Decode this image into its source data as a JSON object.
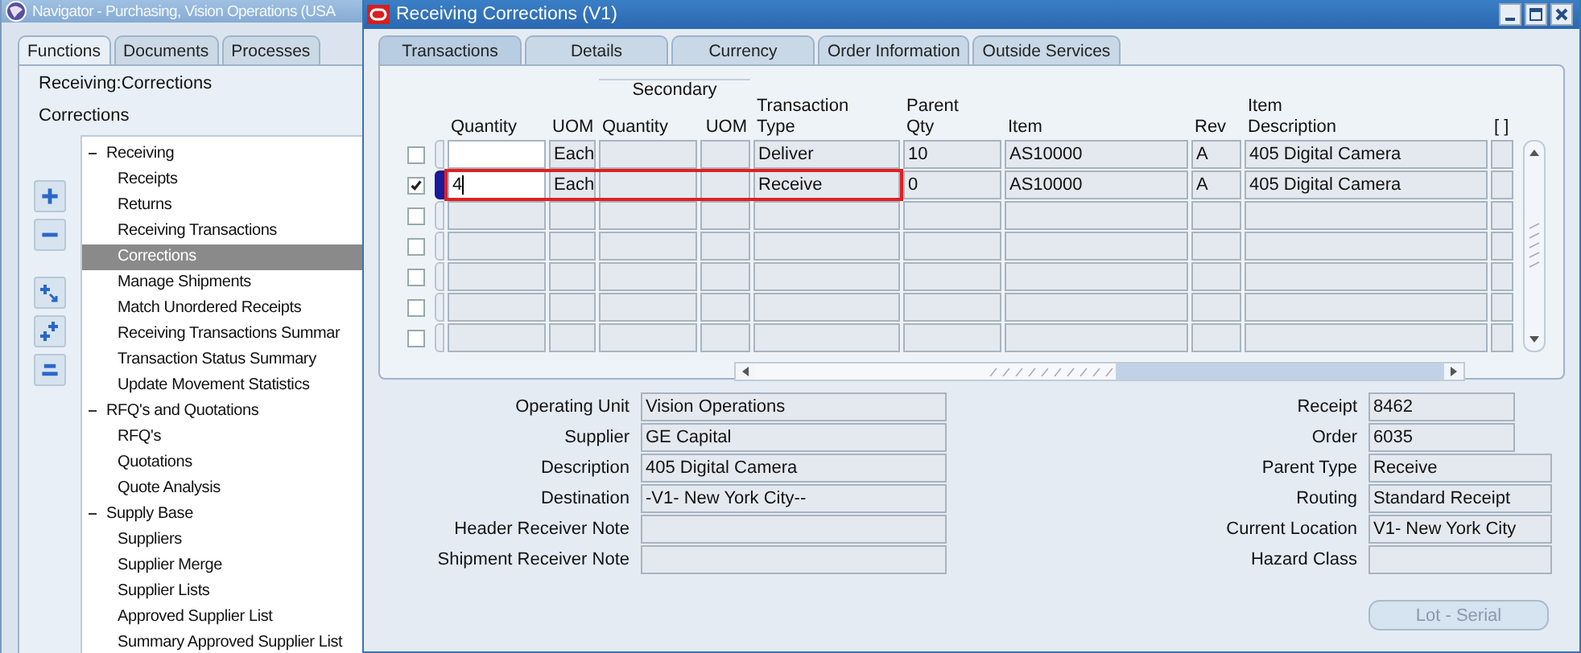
{
  "navigator": {
    "title": "Navigator - Purchasing, Vision Operations (USA",
    "tabs": [
      {
        "label": "Functions",
        "selected": true
      },
      {
        "label": "Documents",
        "selected": false
      },
      {
        "label": "Processes",
        "selected": false
      }
    ],
    "path": "Receiving:Corrections",
    "current": "Corrections",
    "tree": [
      {
        "label": "Receiving",
        "expanded": true,
        "selected": false,
        "children": [
          {
            "label": "Receipts",
            "selected": false
          },
          {
            "label": "Returns",
            "selected": false
          },
          {
            "label": "Receiving Transactions",
            "selected": false
          },
          {
            "label": "Corrections",
            "selected": true
          },
          {
            "label": "Manage Shipments",
            "selected": false
          },
          {
            "label": "Match Unordered Receipts",
            "selected": false
          },
          {
            "label": "Receiving Transactions Summar",
            "selected": false
          },
          {
            "label": "Transaction Status Summary",
            "selected": false
          },
          {
            "label": "Update Movement Statistics",
            "selected": false
          }
        ]
      },
      {
        "label": "RFQ's and Quotations",
        "expanded": true,
        "selected": false,
        "children": [
          {
            "label": "RFQ's",
            "selected": false
          },
          {
            "label": "Quotations",
            "selected": false
          },
          {
            "label": "Quote Analysis",
            "selected": false
          }
        ]
      },
      {
        "label": "Supply Base",
        "expanded": true,
        "selected": false,
        "children": [
          {
            "label": "Suppliers",
            "selected": false
          },
          {
            "label": "Supplier Merge",
            "selected": false
          },
          {
            "label": "Supplier Lists",
            "selected": false
          },
          {
            "label": "Approved Supplier List",
            "selected": false
          },
          {
            "label": "Summary Approved Supplier List",
            "selected": false
          }
        ]
      }
    ]
  },
  "window": {
    "title": "Receiving Corrections (V1)",
    "tabs": [
      {
        "label": "Transactions",
        "selected": true
      },
      {
        "label": "Details",
        "selected": false
      },
      {
        "label": "Currency",
        "selected": false
      },
      {
        "label": "Order Information",
        "selected": false
      },
      {
        "label": "Outside Services",
        "selected": false
      }
    ],
    "group_header": "Secondary",
    "columns": [
      {
        "label": "Quantity"
      },
      {
        "label": "UOM"
      },
      {
        "label": "Quantity"
      },
      {
        "label": "UOM"
      },
      {
        "label": "Transaction\nType"
      },
      {
        "label": "Parent\nQty"
      },
      {
        "label": "Item"
      },
      {
        "label": "Rev"
      },
      {
        "label": "Item\nDescription"
      },
      {
        "label": "[ ]"
      }
    ],
    "rows": [
      {
        "checked": false,
        "current": false,
        "highlighted": false,
        "editable": true,
        "cells": [
          {},
          {
            "text": "Each"
          },
          {},
          {},
          {
            "text": "Deliver"
          },
          {
            "text": "10"
          },
          {
            "text": "AS10000"
          },
          {
            "text": "A"
          },
          {
            "text": "405 Digital Camera"
          },
          {}
        ]
      },
      {
        "checked": true,
        "current": true,
        "highlighted": true,
        "editable": true,
        "cells": [
          {
            "text": "4"
          },
          {
            "text": "Each"
          },
          {},
          {},
          {
            "text": "Receive"
          },
          {
            "text": "0"
          },
          {
            "text": "AS10000"
          },
          {
            "text": "A"
          },
          {
            "text": "405 Digital Camera"
          },
          {}
        ]
      },
      {
        "checked": false,
        "current": false,
        "highlighted": false,
        "editable": false
      },
      {
        "checked": false,
        "current": false,
        "highlighted": false,
        "editable": false
      },
      {
        "checked": false,
        "current": false,
        "highlighted": false,
        "editable": false
      },
      {
        "checked": false,
        "current": false,
        "highlighted": false,
        "editable": false
      },
      {
        "checked": false,
        "current": false,
        "highlighted": false,
        "editable": false
      }
    ],
    "left_fields": [
      {
        "label": "Operating Unit",
        "value": "Vision Operations"
      },
      {
        "label": "Supplier",
        "value": "GE Capital"
      },
      {
        "label": "Description",
        "value": "405 Digital Camera"
      },
      {
        "label": "Destination",
        "value": "-V1- New York City--"
      },
      {
        "label": "Header Receiver Note"
      },
      {
        "label": "Shipment Receiver Note"
      }
    ],
    "right_fields": [
      {
        "label": "Receipt",
        "value": "8462",
        "kind": "short"
      },
      {
        "label": "Order",
        "value": "6035",
        "kind": "short"
      },
      {
        "label": "Parent Type",
        "value": "Receive",
        "kind": "long"
      },
      {
        "label": "Routing",
        "value": "Standard Receipt",
        "kind": "long"
      },
      {
        "label": "Current Location",
        "value": "V1- New York City",
        "kind": "long"
      },
      {
        "label": "Hazard Class",
        "kind": "long"
      }
    ],
    "button": {
      "label": "Lot - Serial",
      "disabled": true
    }
  }
}
